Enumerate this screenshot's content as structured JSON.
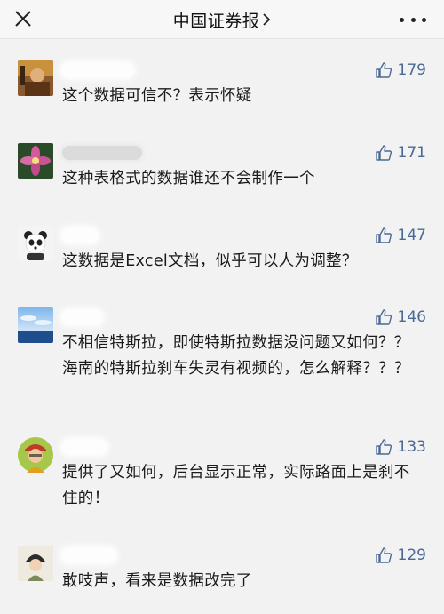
{
  "header": {
    "title": "中国证券报",
    "chevron_icon": "chevron-right-icon",
    "close_icon": "close-icon",
    "more_icon": "more-dots-icon"
  },
  "colors": {
    "like_color": "#4a6a94",
    "background": "#f2f2f2",
    "text": "#1a1a1a"
  },
  "comments": [
    {
      "avatar": "avatar-photo-warm",
      "likes": "179",
      "text": "这个数据可信不？表示怀疑"
    },
    {
      "avatar": "avatar-flower",
      "likes": "171",
      "text": "这种表格式的数据谁还不会制作一个"
    },
    {
      "avatar": "avatar-panda",
      "likes": "147",
      "text": "这数据是Excel文档，似乎可以人为调整？"
    },
    {
      "avatar": "avatar-sea-sky",
      "likes": "146",
      "text": "不相信特斯拉，即使特斯拉数据没问题又如何？？海南的特斯拉刹车失灵有视频的，怎么解释？？？"
    },
    {
      "avatar": "avatar-cartoon-person",
      "likes": "133",
      "text": "提供了又如何，后台显示正常，实际路面上是刹不住的！"
    },
    {
      "avatar": "avatar-girl-hat",
      "likes": "129",
      "text": "敢吱声，看来是数据改完了"
    }
  ]
}
